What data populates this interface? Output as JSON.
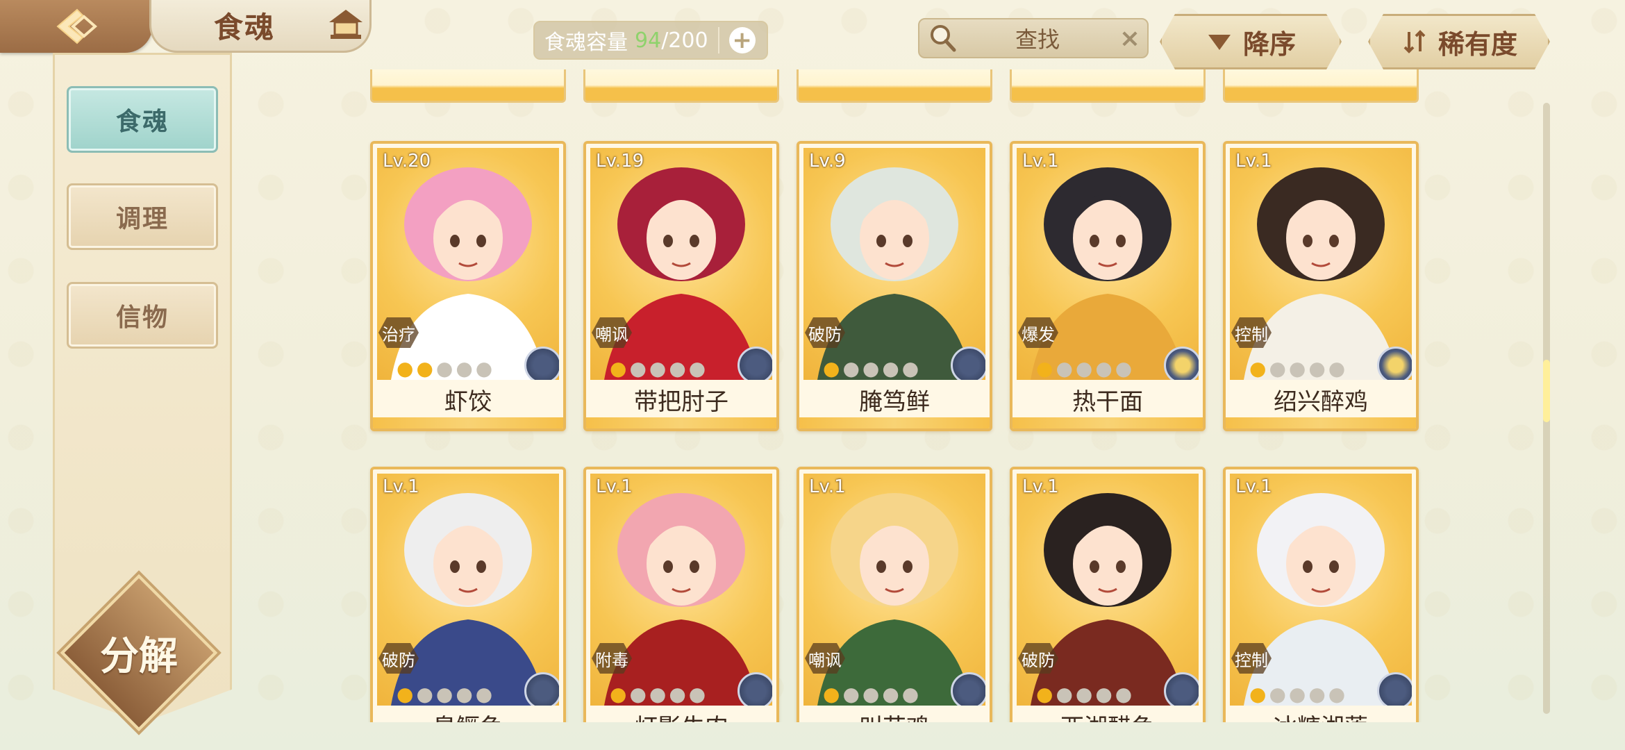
{
  "header": {
    "title": "食魂",
    "capacity_label": "食魂容量",
    "capacity_current": "94",
    "capacity_max": "/200",
    "search_label": "查找",
    "sort_label": "降序",
    "filter_label": "稀有度"
  },
  "sidebar": {
    "items": [
      {
        "label": "食魂",
        "active": true
      },
      {
        "label": "调理",
        "active": false
      },
      {
        "label": "信物",
        "active": false
      }
    ],
    "decompose_label": "分解"
  },
  "cards": [
    {
      "level": "Lv.20",
      "role": "治疗",
      "stars": 2,
      "name": "虾饺",
      "element": "blue",
      "hair": "#f3a0c2",
      "outfit": "#ffffff"
    },
    {
      "level": "Lv.19",
      "role": "嘲讽",
      "stars": 1,
      "name": "带把肘子",
      "element": "blue",
      "hair": "#a8203a",
      "outfit": "#c8202c"
    },
    {
      "level": "Lv.9",
      "role": "破防",
      "stars": 1,
      "name": "腌笃鲜",
      "element": "blue",
      "hair": "#dfe6de",
      "outfit": "#3f5a3c"
    },
    {
      "level": "Lv.1",
      "role": "爆发",
      "stars": 1,
      "name": "热干面",
      "element": "gold",
      "hair": "#2d2a30",
      "outfit": "#e9a93a"
    },
    {
      "level": "Lv.1",
      "role": "控制",
      "stars": 1,
      "name": "绍兴醉鸡",
      "element": "gold",
      "hair": "#3a2a22",
      "outfit": "#f4f0e6"
    },
    {
      "level": "Lv.1",
      "role": "破防",
      "stars": 1,
      "name": "臭鳜鱼",
      "element": "blue",
      "hair": "#eeeeee",
      "outfit": "#3a4a8a"
    },
    {
      "level": "Lv.1",
      "role": "附毒",
      "stars": 1,
      "name": "灯影牛肉",
      "element": "blue",
      "hair": "#f2a6b0",
      "outfit": "#a82020"
    },
    {
      "level": "Lv.1",
      "role": "嘲讽",
      "stars": 1,
      "name": "叫花鸡",
      "element": "blue",
      "hair": "#f6d58a",
      "outfit": "#3d6a3a"
    },
    {
      "level": "Lv.1",
      "role": "破防",
      "stars": 1,
      "name": "西湖醋鱼",
      "element": "blue",
      "hair": "#2a2220",
      "outfit": "#7a2a20"
    },
    {
      "level": "Lv.1",
      "role": "控制",
      "stars": 1,
      "name": "冰糖湘莲",
      "element": "blue",
      "hair": "#f2f2f5",
      "outfit": "#e9eef2"
    }
  ],
  "colors": {
    "accent_gold": "#f5c04a",
    "active_tab": "#a8d8d0",
    "capacity_green": "#8fd26c",
    "star_on": "#f2b21b"
  }
}
